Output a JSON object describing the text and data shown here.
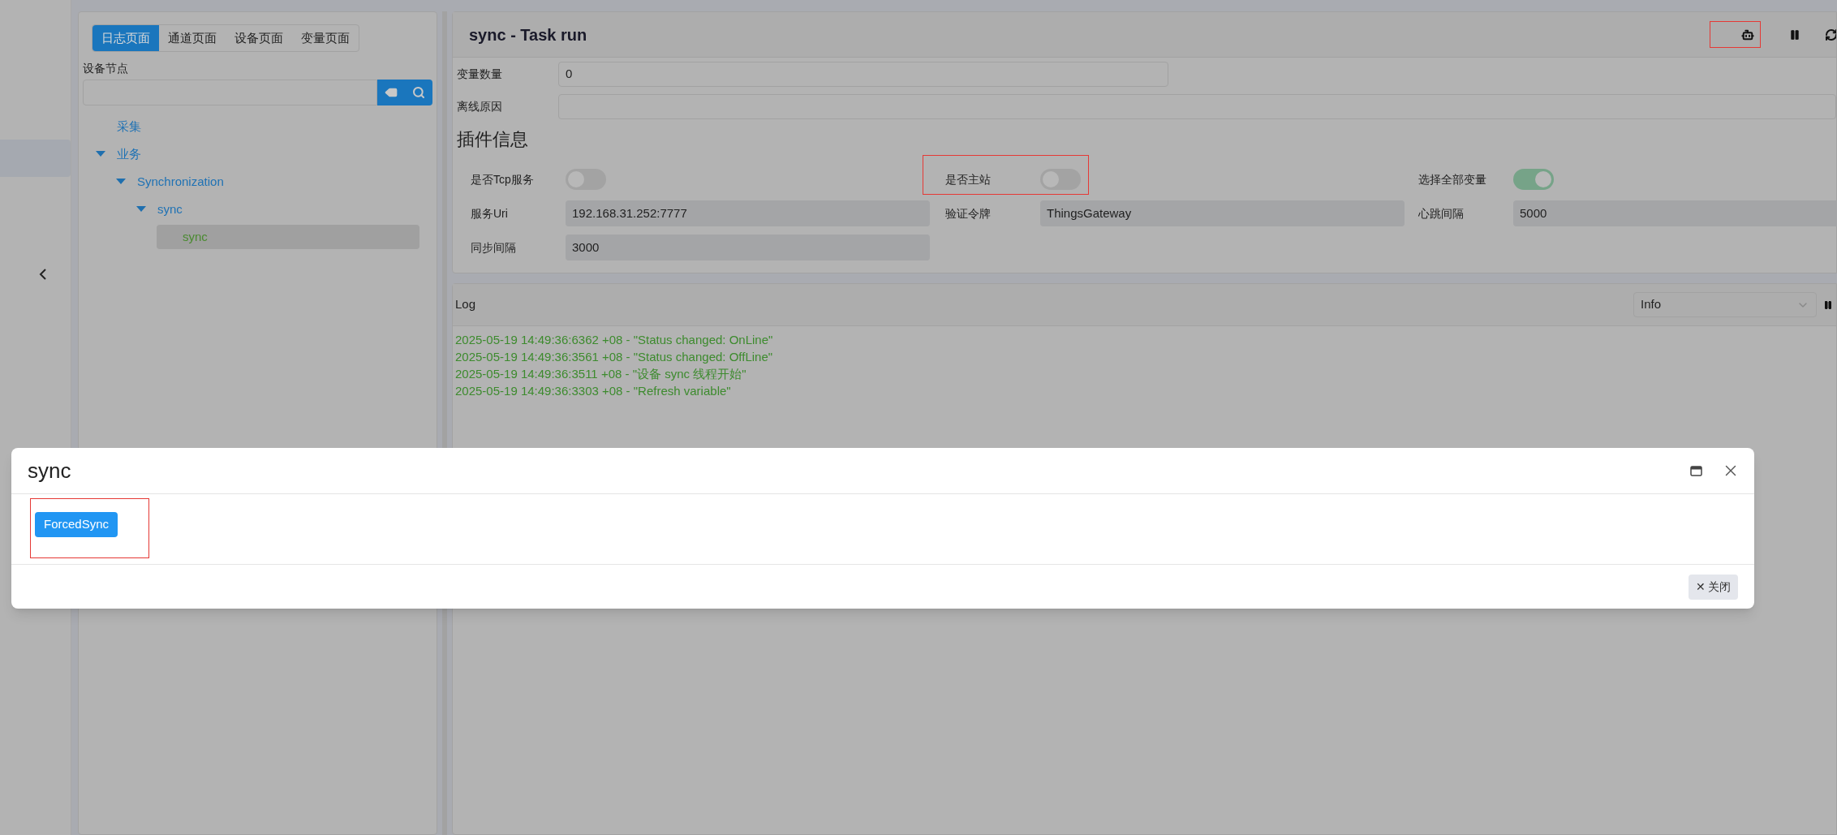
{
  "tree_panel": {
    "tabs": [
      {
        "label": "日志页面",
        "selected": true
      },
      {
        "label": "通道页面",
        "selected": false
      },
      {
        "label": "设备页面",
        "selected": false
      },
      {
        "label": "变量页面",
        "selected": false
      }
    ],
    "search_label": "设备节点",
    "tree": [
      {
        "label": "采集",
        "selected": false
      },
      {
        "label": "业务",
        "expanded": true,
        "selected": false,
        "children": [
          {
            "label": "Synchronization",
            "expanded": true,
            "selected": false,
            "children": [
              {
                "label": "sync",
                "expanded": true,
                "selected": false,
                "children": [
                  {
                    "label": "sync",
                    "selected": true
                  }
                ]
              }
            ]
          }
        ]
      }
    ]
  },
  "main": {
    "title": "sync - Task run",
    "status_fields": [
      {
        "label": "变量数量",
        "value": "0"
      },
      {
        "label": "离线原因"
      }
    ],
    "plugin_title": "插件信息",
    "plugin_items": [
      {
        "kind": "switch",
        "label": "是否Tcp服务",
        "on": false
      },
      {
        "kind": "switch",
        "label": "是否主站",
        "on": false
      },
      {
        "kind": "switch",
        "label": "选择全部变量",
        "on": true
      },
      {
        "kind": "field",
        "label": "服务Uri",
        "value": "192.168.31.252:7777"
      },
      {
        "kind": "field",
        "label": "验证令牌",
        "value": "ThingsGateway"
      },
      {
        "kind": "field",
        "label": "心跳间隔",
        "value": "5000"
      },
      {
        "kind": "field",
        "label": "同步间隔",
        "value": "3000"
      }
    ],
    "log": {
      "title": "Log",
      "level": "Info",
      "lines": [
        "2025-05-19 14:49:36:6362 +08 - \"Status changed: OnLine\"",
        "2025-05-19 14:49:36:3561 +08 - \"Status changed: OffLine\"",
        "2025-05-19 14:49:36:3511 +08 - \"设备 sync 线程开始\"",
        "2025-05-19 14:49:36:3303 +08 - \"Refresh variable\""
      ]
    }
  },
  "dialog": {
    "title": "sync",
    "action": "ForcedSync",
    "close_icon": "✕",
    "close_label": "关闭"
  }
}
